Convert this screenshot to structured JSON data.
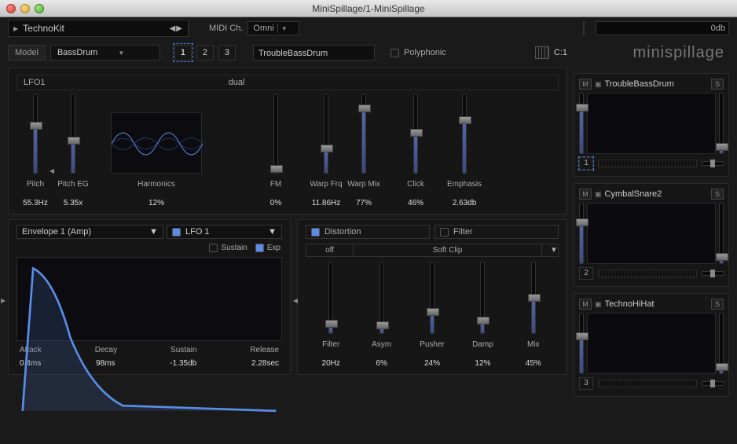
{
  "window": {
    "title": "MiniSpillage/1-MiniSpillage"
  },
  "brand": "minispillage",
  "topbar": {
    "preset_name": "TechnoKit",
    "midi_label": "MIDI Ch.",
    "midi_value": "Omni",
    "vu_label": "0db"
  },
  "modelrow": {
    "model_label": "Model",
    "model_value": "BassDrum",
    "slots": [
      "1",
      "2",
      "3"
    ],
    "active_slot": 0,
    "patch_name": "TroubleBassDrum",
    "poly_label": "Polyphonic",
    "poly_on": false,
    "keymap": "C:1"
  },
  "osc": {
    "lfo_name": "LFO1",
    "mode": "dual",
    "params": [
      {
        "name": "Pitch",
        "value": "55.3Hz",
        "pct": 55
      },
      {
        "name": "Pitch EG",
        "value": "5.35x",
        "pct": 36
      },
      {
        "name": "Harmonics",
        "value": "12%",
        "pct": null
      },
      {
        "name": "FM",
        "value": "0%",
        "pct": 0
      },
      {
        "name": "Warp Frq",
        "value": "11.86Hz",
        "pct": 26
      },
      {
        "name": "Warp Mix",
        "value": "77%",
        "pct": 77
      },
      {
        "name": "Click",
        "value": "46%",
        "pct": 46
      },
      {
        "name": "Emphasis",
        "value": "2.63db",
        "pct": 62
      }
    ]
  },
  "env": {
    "selector": "Envelope 1 (Amp)",
    "lfo_toggle": "LFO 1",
    "checks": [
      {
        "label": "Sustain",
        "on": false
      },
      {
        "label": "Exp",
        "on": true
      }
    ],
    "stages": [
      {
        "name": "Attack",
        "value": "0.4ms"
      },
      {
        "name": "Decay",
        "value": "98ms"
      },
      {
        "name": "Sustain",
        "value": "-1.35db"
      },
      {
        "name": "Release",
        "value": "2.28sec"
      }
    ]
  },
  "fx": {
    "distortion_label": "Distortion",
    "distortion_on": true,
    "filter_label": "Filter",
    "filter_on": false,
    "algo_off": "off",
    "algo_name": "Soft Clip",
    "params": [
      {
        "name": "Filter",
        "value": "20Hz",
        "pct": 8
      },
      {
        "name": "Asym",
        "value": "6%",
        "pct": 6
      },
      {
        "name": "Pusher",
        "value": "24%",
        "pct": 24
      },
      {
        "name": "Damp",
        "value": "12%",
        "pct": 12
      },
      {
        "name": "Mix",
        "value": "45%",
        "pct": 45
      }
    ]
  },
  "pads": [
    {
      "num": "1",
      "name": "TroubleBassDrum",
      "selected": true,
      "vol": 70,
      "pan": 50,
      "send": 4
    },
    {
      "num": "2",
      "name": "CymbalSnare2",
      "selected": false,
      "vol": 62,
      "pan": 50,
      "send": 4
    },
    {
      "num": "3",
      "name": "TechnoHiHat",
      "selected": false,
      "vol": 55,
      "pan": 50,
      "send": 4
    }
  ],
  "mute": "M",
  "solo": "S"
}
